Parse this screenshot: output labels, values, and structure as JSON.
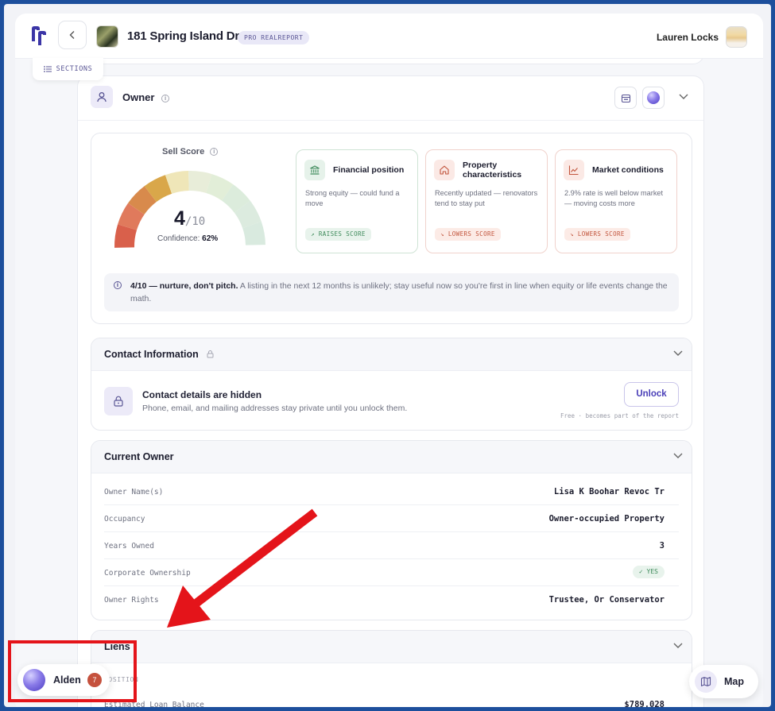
{
  "header": {
    "property_title": "181 Spring Island Dr",
    "badge": "PRO REALREPORT",
    "user_name": "Lauren Locks",
    "sections_label": "SECTIONS"
  },
  "owner_section": {
    "title": "Owner"
  },
  "sell_score": {
    "label": "Sell Score",
    "score": "4",
    "out_of": "/10",
    "score_value": 4,
    "max_value": 10,
    "confidence_label": "Confidence:",
    "confidence_value": "62%",
    "gauge_colors": [
      "#d9604b",
      "#e07a5c",
      "#d88a4c",
      "#d9a74a",
      "#efe6b8",
      "#e8edd9",
      "#e2eed8",
      "#dcecdc",
      "#dcebdf",
      "#d9eadf"
    ],
    "factors": [
      {
        "title": "Financial position",
        "desc": "Strong equity — could fund a move",
        "tag": "↗ RAISES SCORE",
        "icon": "bank-icon",
        "tone": "#3d8a5a"
      },
      {
        "title": "Property characteristics",
        "desc": "Recently updated — renovators tend to stay put",
        "tag": "↘ LOWERS SCORE",
        "icon": "home-icon",
        "tone": "#c2553d"
      },
      {
        "title": "Market conditions",
        "desc": "2.9% rate is well below market — moving costs more",
        "tag": "↘ LOWERS SCORE",
        "icon": "trend-chart-icon",
        "tone": "#c2553d"
      }
    ],
    "note_bold": "4/10 — nurture, don't pitch.",
    "note_text": " A listing in the next 12 months is unlikely; stay useful now so you're first in line when equity or life events change the math."
  },
  "contact_info": {
    "title": "Contact Information",
    "hidden_title": "Contact details are hidden",
    "hidden_desc": "Phone, email, and mailing addresses stay private until you unlock them.",
    "unlock_label": "Unlock",
    "free_note": "Free · becomes part of the report"
  },
  "current_owner": {
    "title": "Current Owner",
    "rows": [
      {
        "key": "Owner Name(s)",
        "value": "Lisa K Boohar Revoc Tr"
      },
      {
        "key": "Occupancy",
        "value": "Owner-occupied Property"
      },
      {
        "key": "Years Owned",
        "value": "3"
      },
      {
        "key": "Corporate Ownership",
        "value": "✓ YES"
      },
      {
        "key": "Owner Rights",
        "value": "Trustee, Or Conservator"
      }
    ]
  },
  "liens": {
    "title": "Liens",
    "caption": "POSITION",
    "row_key": "Estimated Loan Balance",
    "row_value": "$789,028"
  },
  "assistant": {
    "name": "Alden",
    "count": "7"
  },
  "map_button": {
    "label": "Map"
  }
}
